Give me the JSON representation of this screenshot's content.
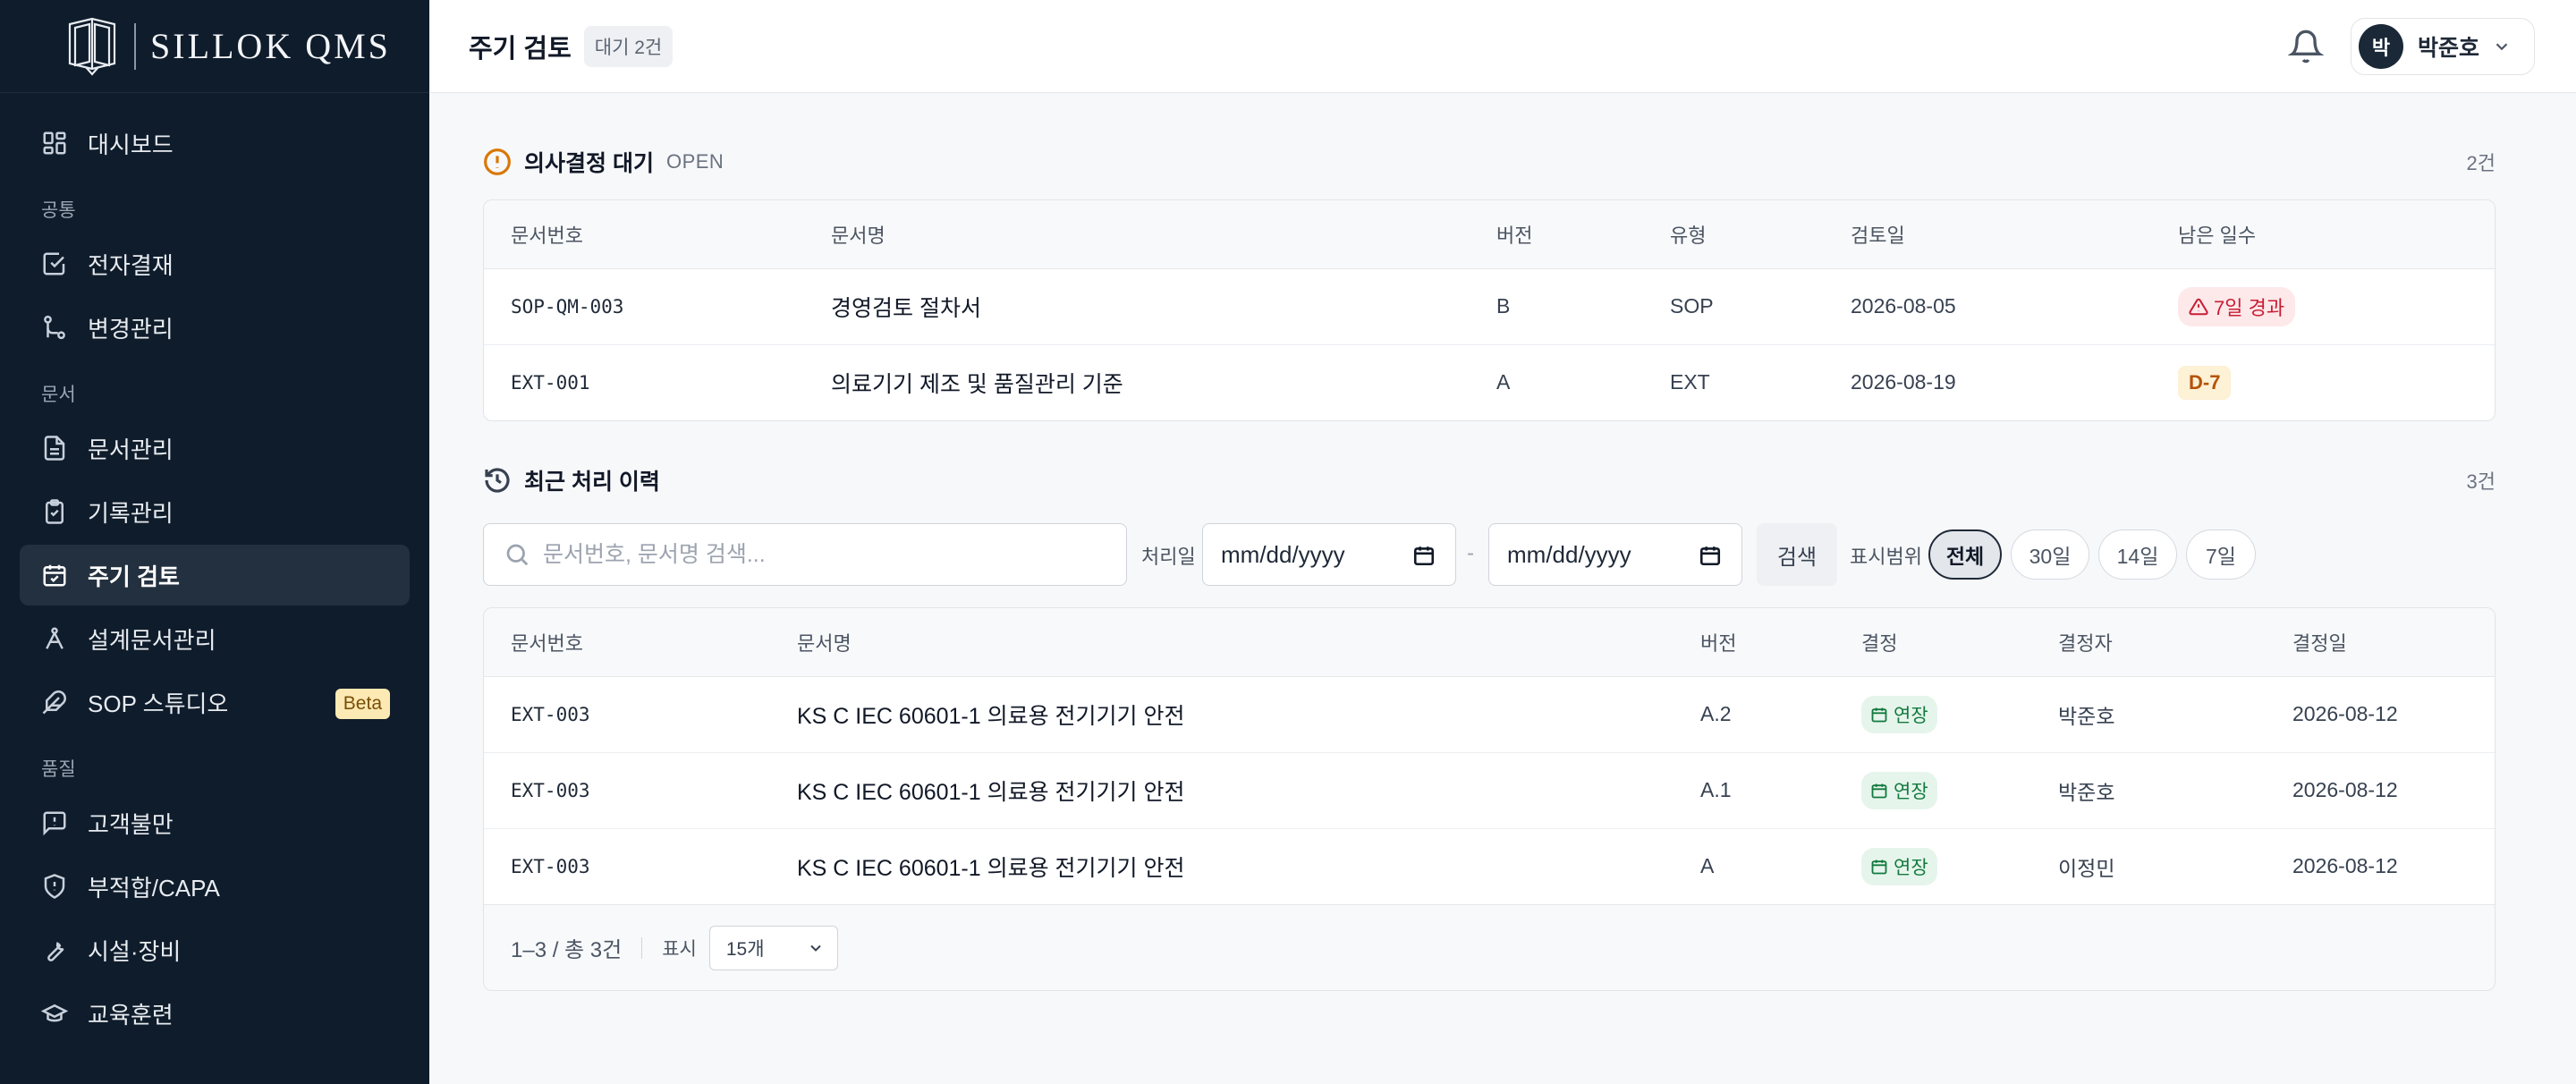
{
  "brand": {
    "name": "SILLOK QMS"
  },
  "sidebar": {
    "items": [
      {
        "label": "대시보드",
        "icon": "dashboard-icon"
      },
      {
        "section": "공통"
      },
      {
        "label": "전자결재",
        "icon": "checkbox-icon"
      },
      {
        "label": "변경관리",
        "icon": "git-branch-icon"
      },
      {
        "section": "문서"
      },
      {
        "label": "문서관리",
        "icon": "document-icon"
      },
      {
        "label": "기록관리",
        "icon": "clipboard-icon"
      },
      {
        "label": "주기 검토",
        "icon": "calendar-icon",
        "active": true
      },
      {
        "label": "설계문서관리",
        "icon": "compass-icon"
      },
      {
        "label": "SOP 스튜디오",
        "icon": "feather-icon",
        "badge": "Beta"
      },
      {
        "section": "품질"
      },
      {
        "label": "고객불만",
        "icon": "message-alert-icon"
      },
      {
        "label": "부적합/CAPA",
        "icon": "shield-icon"
      },
      {
        "label": "시설·장비",
        "icon": "wrench-icon"
      },
      {
        "label": "교육훈련",
        "icon": "graduation-cap-icon"
      }
    ]
  },
  "header": {
    "title": "주기 검토",
    "pending_badge": "대기 2건",
    "user": {
      "avatar_initial": "박",
      "name": "박준호"
    }
  },
  "pending": {
    "title": "의사결정 대기",
    "tag": "OPEN",
    "count": "2건",
    "columns": [
      "문서번호",
      "문서명",
      "버전",
      "유형",
      "검토일",
      "남은 일수"
    ],
    "rows": [
      {
        "doc_no": "SOP-QM-003",
        "doc_name": "경영검토 절차서",
        "version": "B",
        "type": "SOP",
        "review_date": "2026-08-05",
        "remaining": "7일 경과",
        "status": "overdue"
      },
      {
        "doc_no": "EXT-001",
        "doc_name": "의료기기 제조 및 품질관리 기준",
        "version": "A",
        "type": "EXT",
        "review_date": "2026-08-19",
        "remaining": "D-7",
        "status": "due"
      }
    ]
  },
  "history": {
    "title": "최근 처리 이력",
    "count": "3건",
    "search_placeholder": "문서번호, 문서명 검색...",
    "date_label": "처리일",
    "date_from": "mm/dd/yyyy",
    "date_to": "mm/dd/yyyy",
    "date_sep": "-",
    "search_button": "검색",
    "range_label": "표시범위",
    "ranges": [
      "전체",
      "30일",
      "14일",
      "7일"
    ],
    "active_range": "전체",
    "columns": [
      "문서번호",
      "문서명",
      "버전",
      "결정",
      "결정자",
      "결정일"
    ],
    "rows": [
      {
        "doc_no": "EXT-003",
        "doc_name": "KS C IEC 60601-1 의료용 전기기기 안전",
        "version": "A.2",
        "decision": "연장",
        "decider": "박준호",
        "decision_date": "2026-08-12"
      },
      {
        "doc_no": "EXT-003",
        "doc_name": "KS C IEC 60601-1 의료용 전기기기 안전",
        "version": "A.1",
        "decision": "연장",
        "decider": "박준호",
        "decision_date": "2026-08-12"
      },
      {
        "doc_no": "EXT-003",
        "doc_name": "KS C IEC 60601-1 의료용 전기기기 안전",
        "version": "A",
        "decision": "연장",
        "decider": "이정민",
        "decision_date": "2026-08-12"
      }
    ],
    "pagination": {
      "range_text": "1–3 / 총 3건",
      "page_size_label": "표시",
      "page_size": "15개"
    }
  }
}
